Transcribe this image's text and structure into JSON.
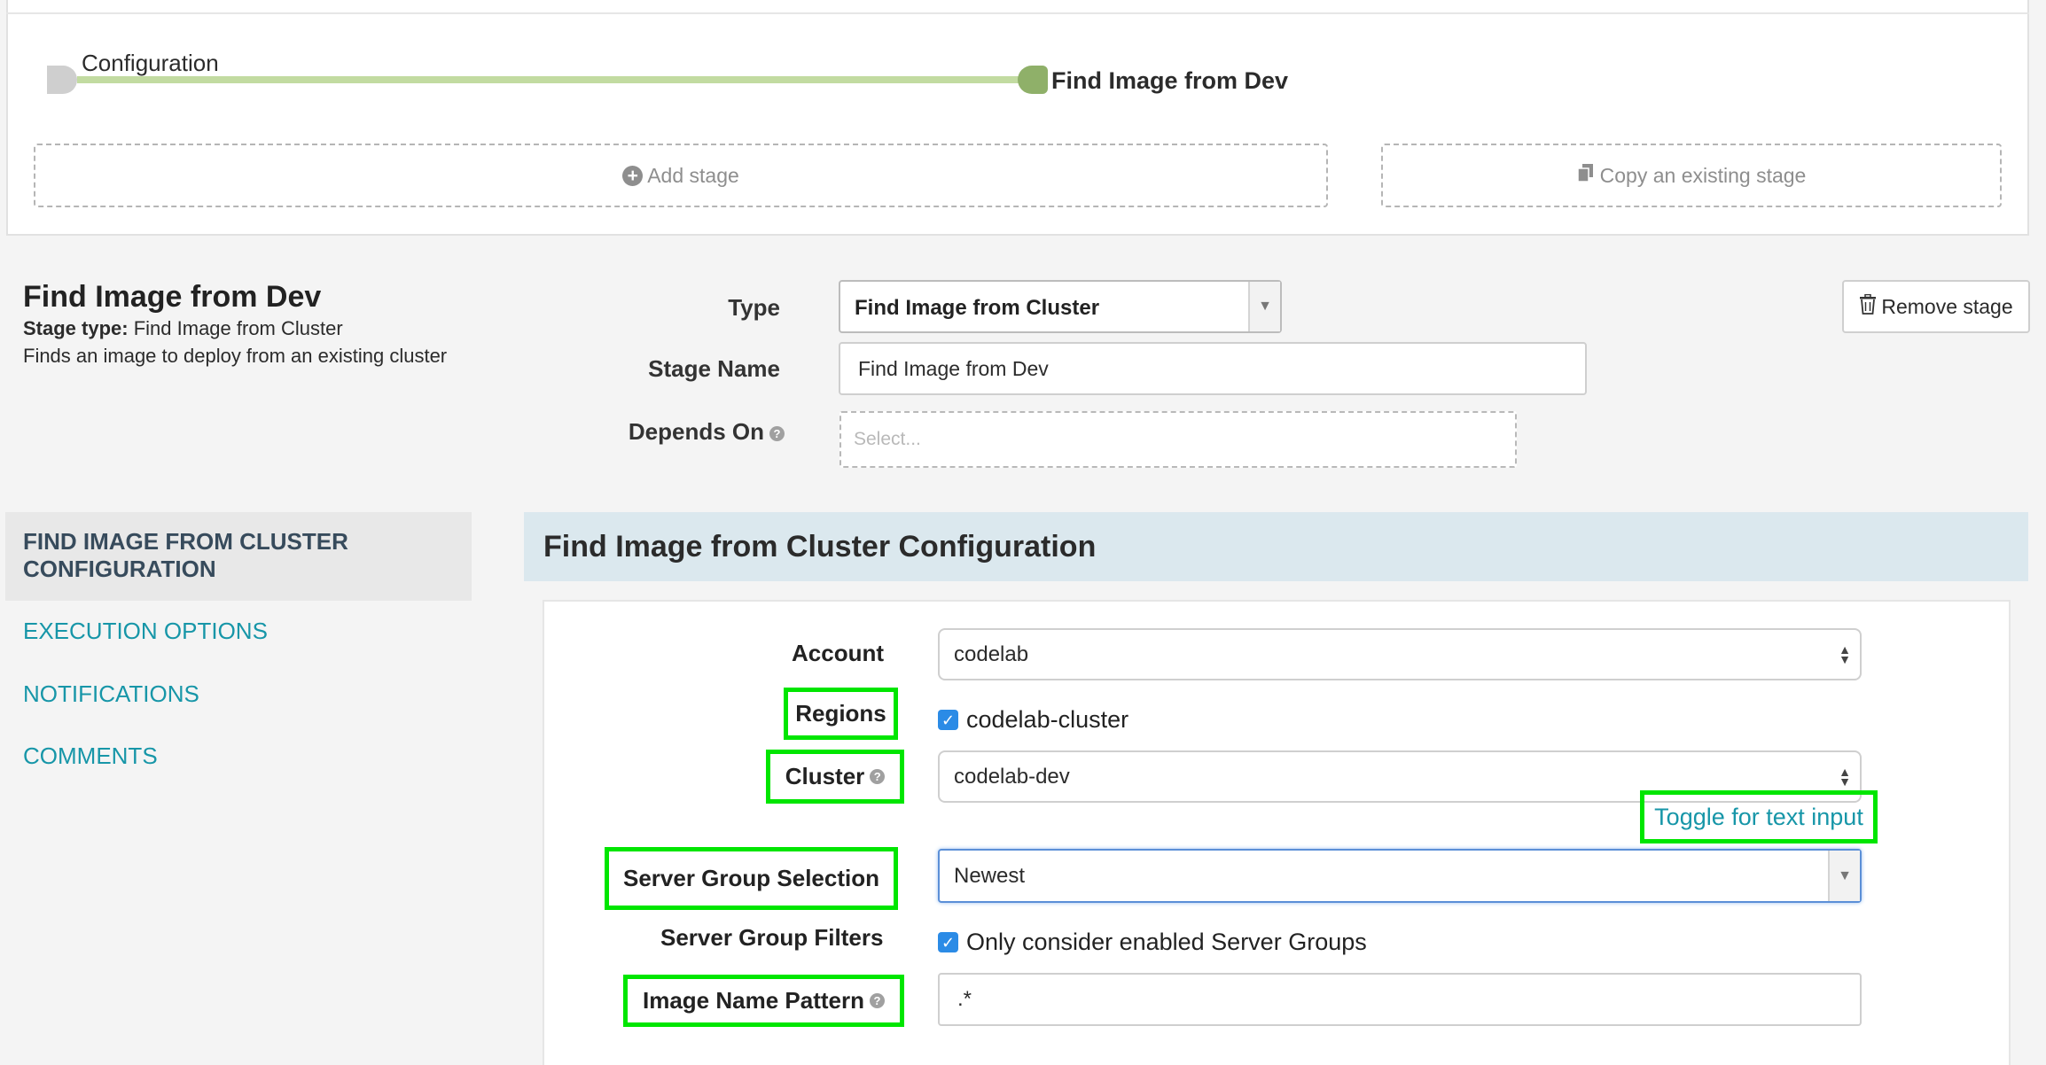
{
  "pipeline": {
    "start_label": "Configuration",
    "end_label": "Find Image from Dev",
    "add_stage": "Add stage",
    "copy_stage": "Copy an existing stage"
  },
  "stage": {
    "title": "Find Image from Dev",
    "type_prefix": "Stage type:",
    "type_value": "Find Image from Cluster",
    "description": "Finds an image to deploy from an existing cluster",
    "remove_label": "Remove stage"
  },
  "form": {
    "type_label": "Type",
    "type_value": "Find Image from Cluster",
    "stage_name_label": "Stage Name",
    "stage_name_value": "Find Image from Dev",
    "depends_on_label": "Depends On",
    "depends_on_placeholder": "Select..."
  },
  "nav": {
    "items": [
      {
        "label": "FIND IMAGE FROM CLUSTER CONFIGURATION",
        "active": true
      },
      {
        "label": "EXECUTION OPTIONS",
        "active": false
      },
      {
        "label": "NOTIFICATIONS",
        "active": false
      },
      {
        "label": "COMMENTS",
        "active": false
      }
    ]
  },
  "config": {
    "header": "Find Image from Cluster Configuration",
    "account_label": "Account",
    "account_value": "codelab",
    "regions_label": "Regions",
    "region_checkbox_label": "codelab-cluster",
    "cluster_label": "Cluster",
    "cluster_value": "codelab-dev",
    "toggle_text_input": "Toggle for text input",
    "server_group_selection_label": "Server Group Selection",
    "server_group_selection_value": "Newest",
    "server_group_filters_label": "Server Group Filters",
    "filter_checkbox_label": "Only consider enabled Server Groups",
    "image_name_pattern_label": "Image Name Pattern",
    "image_name_pattern_value": ".*"
  },
  "colors": {
    "highlight": "#00e600",
    "link": "#1796a8",
    "section_header_bg": "#dbe8ee",
    "pipeline_node_active": "#8fb069",
    "checkbox": "#2b8be6"
  }
}
